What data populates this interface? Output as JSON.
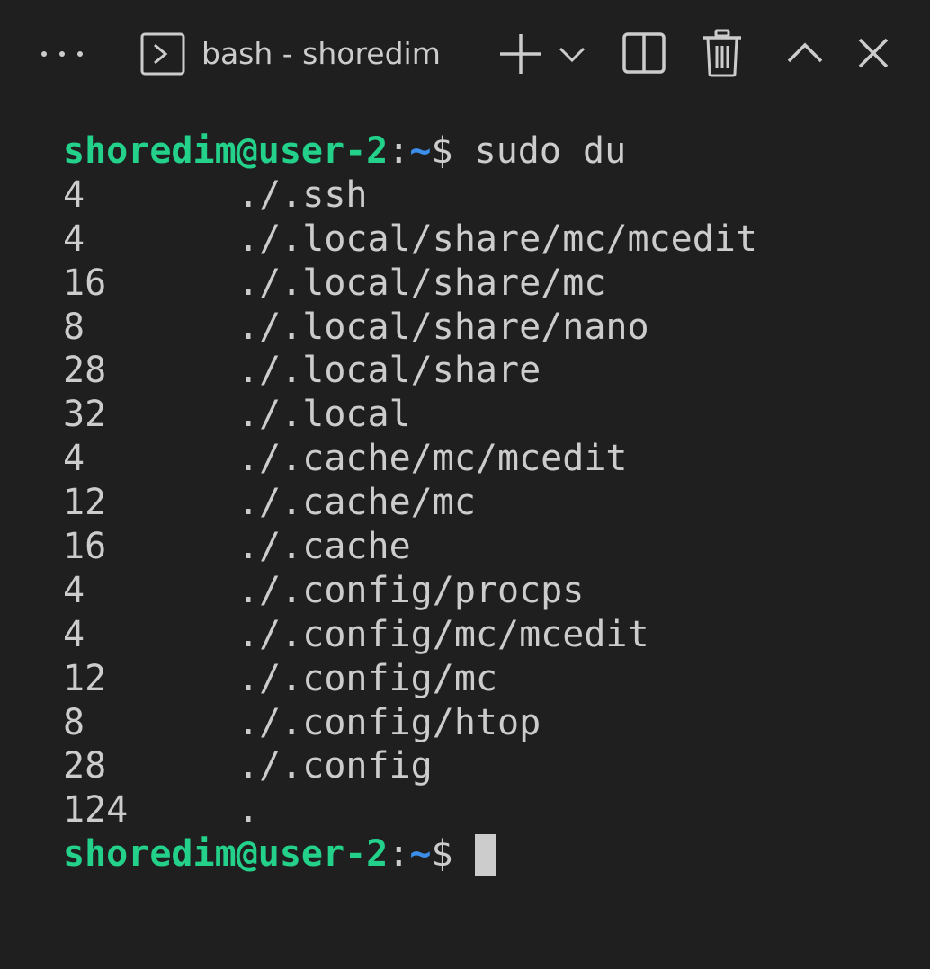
{
  "toolbar": {
    "more_icon": "ellipsis-icon",
    "terminal_icon": "terminal-icon",
    "tab_title": "bash - shoredim",
    "new_terminal_icon": "plus-icon",
    "launch_profile_icon": "chevron-down-icon",
    "split_icon": "split-panel-icon",
    "kill_icon": "trash-icon",
    "maximize_icon": "chevron-up-icon",
    "close_icon": "close-icon"
  },
  "terminal": {
    "prompt": {
      "user_host": "shoredim@user-2",
      "colon": ":",
      "path": "~",
      "dollar": "$"
    },
    "command": "sudo du",
    "output": [
      {
        "size": "4",
        "path": "./.ssh"
      },
      {
        "size": "4",
        "path": "./.local/share/mc/mcedit"
      },
      {
        "size": "16",
        "path": "./.local/share/mc"
      },
      {
        "size": "8",
        "path": "./.local/share/nano"
      },
      {
        "size": "28",
        "path": "./.local/share"
      },
      {
        "size": "32",
        "path": "./.local"
      },
      {
        "size": "4",
        "path": "./.cache/mc/mcedit"
      },
      {
        "size": "12",
        "path": "./.cache/mc"
      },
      {
        "size": "16",
        "path": "./.cache"
      },
      {
        "size": "4",
        "path": "./.config/procps"
      },
      {
        "size": "4",
        "path": "./.config/mc/mcedit"
      },
      {
        "size": "12",
        "path": "./.config/mc"
      },
      {
        "size": "8",
        "path": "./.config/htop"
      },
      {
        "size": "28",
        "path": "./.config"
      },
      {
        "size": "124",
        "path": "."
      }
    ]
  },
  "colors": {
    "background": "#1f1f1f",
    "foreground": "#cccccc",
    "prompt_user": "#23d18b",
    "prompt_path": "#3b8eea"
  }
}
